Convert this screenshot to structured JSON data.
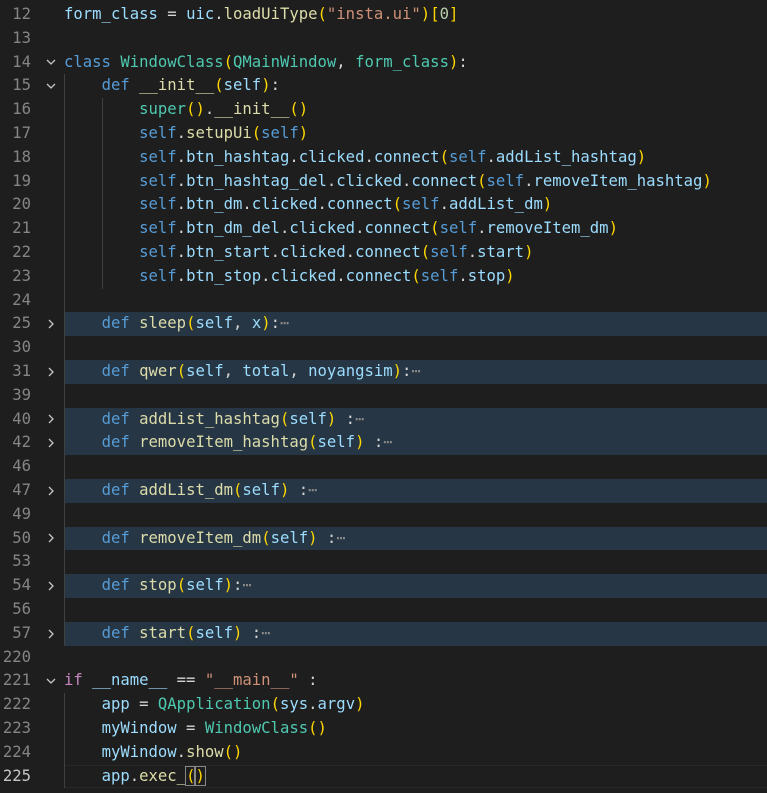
{
  "editor": {
    "theme_colors": {
      "background": "#1e1e1e",
      "folded_line_highlight": "#263644",
      "keyword": "#569cd6",
      "control_keyword": "#c586c0",
      "function": "#dcdcaa",
      "class": "#4ec9b0",
      "variable": "#9cdcfe",
      "string": "#ce9178",
      "number": "#b5cea8"
    },
    "lines": [
      {
        "num": "12",
        "fold": "none",
        "text": "form_class = uic.loadUiType(\"insta.ui\")[0]"
      },
      {
        "num": "13",
        "fold": "none",
        "text": ""
      },
      {
        "num": "14",
        "fold": "expanded",
        "text": "class WindowClass(QMainWindow, form_class):"
      },
      {
        "num": "15",
        "fold": "expanded",
        "text": "def __init__(self):"
      },
      {
        "num": "16",
        "fold": "none",
        "text": "super().__init__()"
      },
      {
        "num": "17",
        "fold": "none",
        "text": "self.setupUi(self)"
      },
      {
        "num": "18",
        "fold": "none",
        "text": "self.btn_hashtag.clicked.connect(self.addList_hashtag)"
      },
      {
        "num": "19",
        "fold": "none",
        "text": "self.btn_hashtag_del.clicked.connect(self.removeItem_hashtag)"
      },
      {
        "num": "20",
        "fold": "none",
        "text": "self.btn_dm.clicked.connect(self.addList_dm)"
      },
      {
        "num": "21",
        "fold": "none",
        "text": "self.btn_dm_del.clicked.connect(self.removeItem_dm)"
      },
      {
        "num": "22",
        "fold": "none",
        "text": "self.btn_start.clicked.connect(self.start)"
      },
      {
        "num": "23",
        "fold": "none",
        "text": "self.btn_stop.clicked.connect(self.stop)"
      },
      {
        "num": "24",
        "fold": "none",
        "text": ""
      },
      {
        "num": "25",
        "fold": "collapsed",
        "text": "def sleep(self, x):"
      },
      {
        "num": "30",
        "fold": "none",
        "text": ""
      },
      {
        "num": "31",
        "fold": "collapsed",
        "text": "def qwer(self, total, noyangsim):"
      },
      {
        "num": "39",
        "fold": "none",
        "text": ""
      },
      {
        "num": "40",
        "fold": "collapsed",
        "text": "def addList_hashtag(self) :"
      },
      {
        "num": "42",
        "fold": "collapsed",
        "text": "def removeItem_hashtag(self) :"
      },
      {
        "num": "46",
        "fold": "none",
        "text": ""
      },
      {
        "num": "47",
        "fold": "collapsed",
        "text": "def addList_dm(self) :"
      },
      {
        "num": "49",
        "fold": "none",
        "text": ""
      },
      {
        "num": "50",
        "fold": "collapsed",
        "text": "def removeItem_dm(self) :"
      },
      {
        "num": "53",
        "fold": "none",
        "text": ""
      },
      {
        "num": "54",
        "fold": "collapsed",
        "text": "def stop(self):"
      },
      {
        "num": "56",
        "fold": "none",
        "text": ""
      },
      {
        "num": "57",
        "fold": "collapsed",
        "text": "def start(self) :"
      },
      {
        "num": "220",
        "fold": "none",
        "text": ""
      },
      {
        "num": "221",
        "fold": "expanded",
        "text": "if __name__ == \"__main__\" :"
      },
      {
        "num": "222",
        "fold": "none",
        "text": "app = QApplication(sys.argv)"
      },
      {
        "num": "223",
        "fold": "none",
        "text": "myWindow = WindowClass()"
      },
      {
        "num": "224",
        "fold": "none",
        "text": "myWindow.show()"
      },
      {
        "num": "225",
        "fold": "none",
        "text": "app.exec_()"
      }
    ],
    "fold_icons": {
      "expanded": "chevron-down-icon",
      "collapsed": "chevron-right-icon"
    },
    "folded_placeholder": "⋯",
    "current_line": "225"
  }
}
